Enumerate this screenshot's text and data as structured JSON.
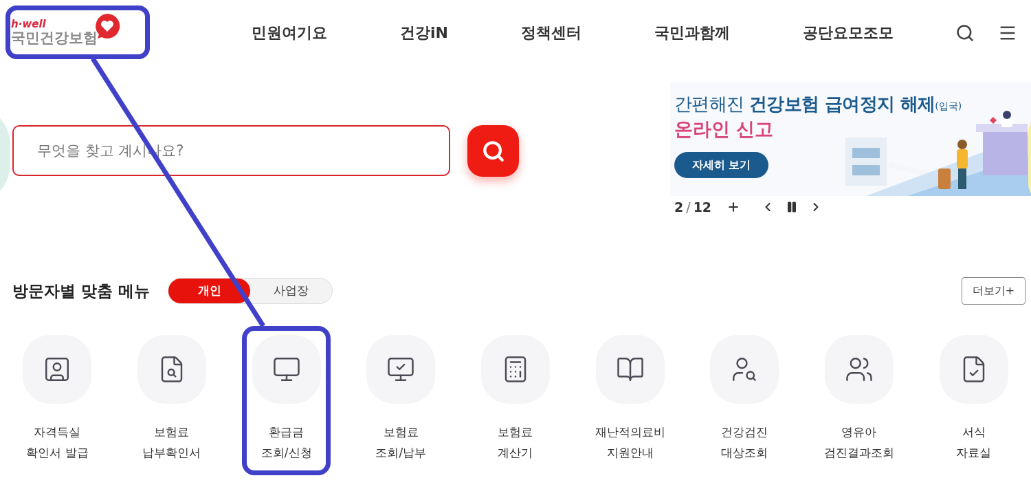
{
  "header": {
    "logo": {
      "tagline": "h·well",
      "name": "국민건강보험"
    },
    "nav": [
      {
        "label": "민원여기요"
      },
      {
        "label": "건강iN"
      },
      {
        "label": "정책센터"
      },
      {
        "label": "국민과함께"
      },
      {
        "label": "공단요모조모"
      }
    ]
  },
  "search": {
    "placeholder": "무엇을 찾고 계시나요?"
  },
  "banner": {
    "headline": "간편해진 **건강보험 급여정지 해제**",
    "headline_note": "(입국)",
    "subline": "온라인 신고",
    "button": "자세히 보기",
    "pager": {
      "current": "2",
      "separator": "/",
      "total": "12"
    }
  },
  "visitor_menu": {
    "title": "방문자별 맞춤 메뉴",
    "tabs": [
      {
        "label": "개인",
        "selected": true
      },
      {
        "label": "사업장",
        "selected": false
      }
    ],
    "more": "더보기+",
    "items": [
      {
        "lines": [
          "자격득실",
          "확인서 발급"
        ]
      },
      {
        "lines": [
          "보험료",
          "납부확인서"
        ]
      },
      {
        "lines": [
          "환급금",
          "조회/신청"
        ]
      },
      {
        "lines": [
          "보험료",
          "조회/납부"
        ]
      },
      {
        "lines": [
          "보험료",
          "계산기"
        ]
      },
      {
        "lines": [
          "재난적의료비",
          "지원안내"
        ]
      },
      {
        "lines": [
          "건강검진",
          "대상조회"
        ]
      },
      {
        "lines": [
          "영유아",
          "검진결과조회"
        ]
      },
      {
        "lines": [
          "서식",
          "자료실"
        ]
      }
    ]
  }
}
